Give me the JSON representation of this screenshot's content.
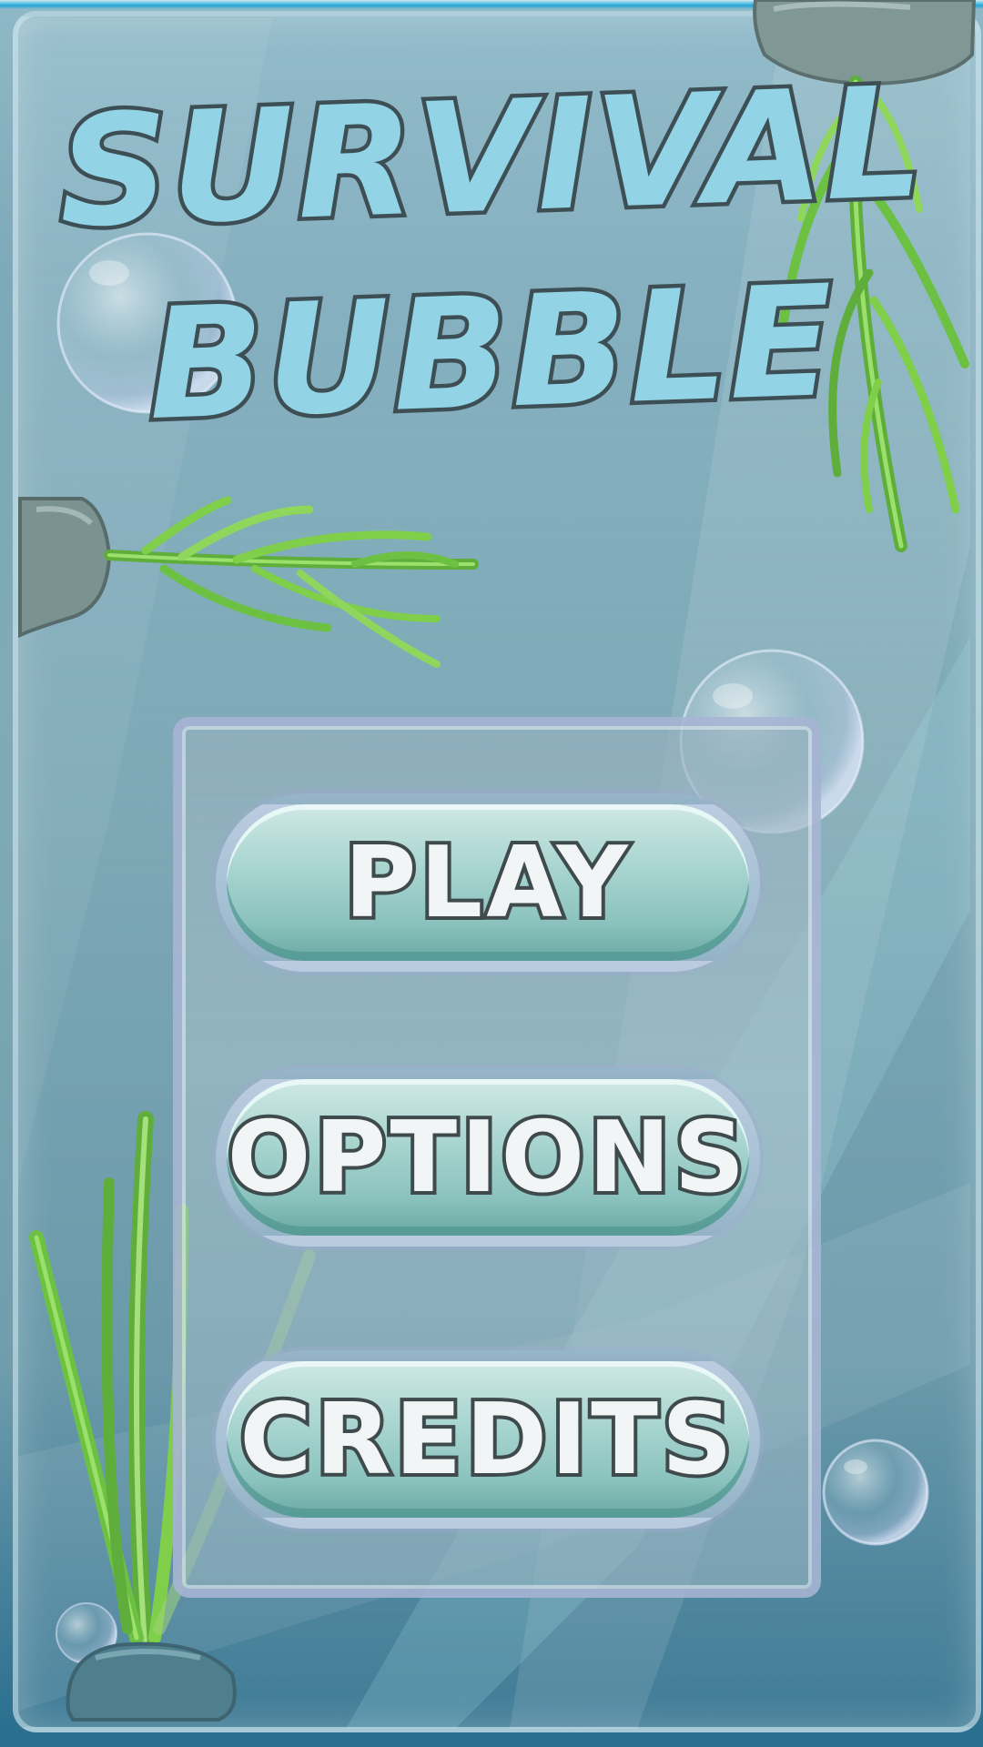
{
  "title": {
    "line1": "Survival",
    "line2": "Bubble"
  },
  "menu": {
    "play_label": "PLAY",
    "options_label": "OPTIONS",
    "credits_label": "CREDITS"
  },
  "colors": {
    "title_fill": "#92d4e6",
    "title_outline": "#3d4f54",
    "button_fill": "#a9d5d0",
    "seaweed": "#7fcf4a",
    "water": "#7faab5"
  },
  "icons": [
    "bubble-icon",
    "seaweed-icon",
    "rock-icon"
  ]
}
